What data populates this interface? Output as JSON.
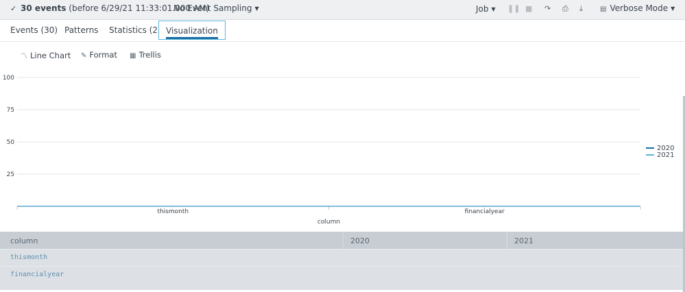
{
  "topbar": {
    "status_check_icon": "check-icon",
    "status_bold": "30 events",
    "status_rest": "(before 6/29/21 11:33:01.000 AM)",
    "sampling_label": "No Event Sampling",
    "job_label": "Job",
    "mode_label": "Verbose Mode"
  },
  "tabs": [
    {
      "label": "Events (30)"
    },
    {
      "label": "Patterns"
    },
    {
      "label": "Statistics (2)"
    },
    {
      "label": "Visualization",
      "active": true
    }
  ],
  "viz_toolbar": {
    "chart_type_label": "Line Chart",
    "format_label": "Format",
    "trellis_label": "Trellis"
  },
  "chart_data": {
    "type": "line",
    "categories": [
      "thismonth",
      "financialyear"
    ],
    "xlabel": "column",
    "ylabel": "",
    "ylim": [
      0,
      100
    ],
    "yticks": [
      "25",
      "50",
      "75",
      "100"
    ],
    "series": [
      {
        "name": "2020",
        "values": [
          0,
          0
        ],
        "color": "#1a6fa3"
      },
      {
        "name": "2021",
        "values": [
          0,
          0
        ],
        "color": "#5bb6d9"
      }
    ],
    "grid": true,
    "legend_position": "right"
  },
  "table": {
    "headers": [
      "column",
      "2020",
      "2021"
    ],
    "rows": [
      [
        "thismonth",
        "",
        ""
      ],
      [
        "financialyear",
        "",
        ""
      ]
    ]
  }
}
